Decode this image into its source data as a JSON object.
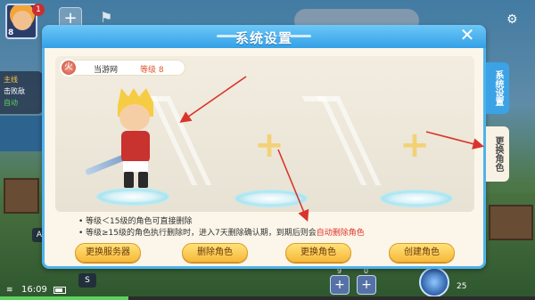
{
  "hud": {
    "level": "8",
    "badge": "1",
    "plus_symbol": "+",
    "quest_lines": [
      "主线",
      "击败敌",
      "自动"
    ],
    "time": "16:09",
    "key_s": "S",
    "key_a": "A",
    "skill_counts": [
      "9",
      "0"
    ],
    "skill_round_count": "25",
    "xp_percent": 24
  },
  "dialog": {
    "title": "系统设置",
    "close_symbol": "✕",
    "server_icon": "火",
    "server_name": "当游网",
    "level_text": "等级 8",
    "rules": {
      "line1": "等级＜15级的角色可直接删除",
      "line2_prefix": "等级≥15级的角色执行删除时，进入7天删除确认期，到期后则会",
      "line2_highlight": "自动删除角色"
    },
    "buttons": {
      "change_server": "更换服务器",
      "delete_role": "删除角色",
      "change_role": "更换角色",
      "create_role": "创建角色"
    },
    "slots": {
      "add_symbol": "+"
    }
  },
  "side_tabs": {
    "system": "系统设置",
    "change_role": "更换角色"
  },
  "colors": {
    "accent_blue": "#3ba3e5",
    "button_gold": "#f6b93a",
    "warning_red": "#e0362c",
    "annotation_arrow": "#d9342b"
  },
  "icons": {
    "close": "close-icon",
    "server": "server-fire-icon",
    "add_slot": "plus-icon",
    "flag": "flag-icon"
  }
}
